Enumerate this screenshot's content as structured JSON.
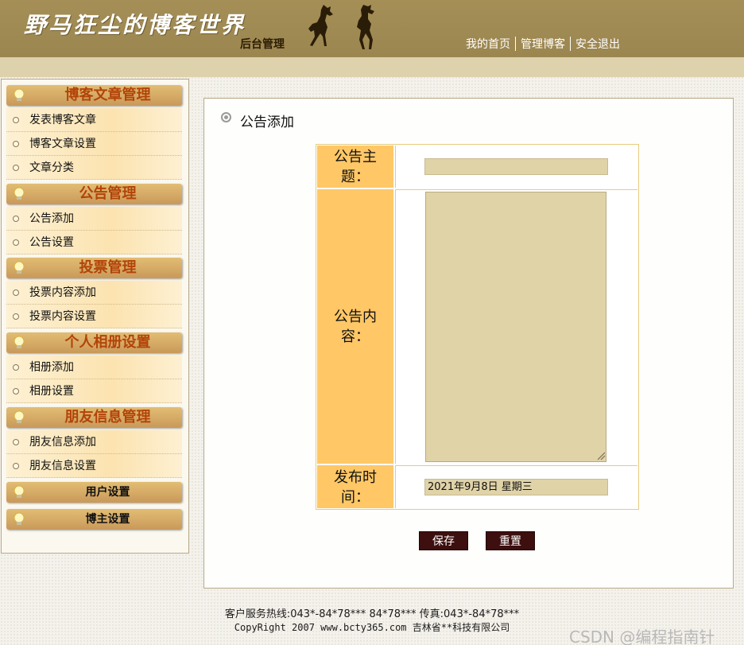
{
  "header": {
    "logo_text": "野马狂尘的博客世界",
    "sub_title": "后台管理",
    "nav": [
      "我的首页",
      "管理博客",
      "安全退出"
    ]
  },
  "sidebar": {
    "groups": [
      {
        "title": "博客文章管理",
        "items": [
          "发表博客文章",
          "博客文章设置",
          "文章分类"
        ]
      },
      {
        "title": "公告管理",
        "items": [
          "公告添加",
          "公告设置"
        ]
      },
      {
        "title": "投票管理",
        "items": [
          "投票内容添加",
          "投票内容设置"
        ]
      },
      {
        "title": "个人相册设置",
        "items": [
          "相册添加",
          "相册设置"
        ]
      },
      {
        "title": "朋友信息管理",
        "items": [
          "朋友信息添加",
          "朋友信息设置"
        ]
      },
      {
        "title": "用户设置",
        "items": []
      },
      {
        "title": "博主设置",
        "items": []
      }
    ]
  },
  "main": {
    "title": "公告添加",
    "form": {
      "subject_label": "公告主题：",
      "subject_value": "",
      "content_label": "公告内容：",
      "content_value": "",
      "time_label": "发布时间：",
      "time_value": "2021年9月8日 星期三"
    },
    "buttons": {
      "save": "保存",
      "reset": "重置"
    }
  },
  "footer": {
    "line1": "客户服务热线:043*-84*78*** 84*78*** 传真:043*-84*78***",
    "line2": "CopyRight 2007 www.bcty365.com 吉林省**科技有限公司"
  },
  "watermark": "CSDN @编程指南针",
  "colors": {
    "header_bg": "#a58f57",
    "menu_title": "#b34408",
    "label_bg": "#ffc766",
    "input_bg": "#e0d3a8",
    "button_bg": "#3d0f0f"
  }
}
